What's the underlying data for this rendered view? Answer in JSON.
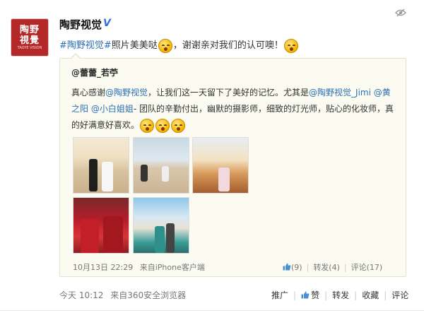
{
  "post": {
    "avatar": {
      "logo_top": "陶野",
      "logo_bottom": "視覺",
      "logo_sub": "TAOYE VISION"
    },
    "username": "陶野视觉",
    "verified_badge": "V",
    "text_tag": "#陶野视觉#",
    "text_main": "照片美美哒",
    "text_after": "，谢谢亲对我们的认可噢！",
    "footer": {
      "time": "今天 10:12",
      "source": "来自360安全浏览器",
      "actions": [
        "推广",
        "赞",
        "转发",
        "收藏",
        "评论"
      ]
    }
  },
  "quote": {
    "user": "@蕾蕾_若苧",
    "text_1": "真心感谢",
    "mention_1": "@陶野视觉",
    "text_2": "，让我们这一天留下了美好的记忆。尤其是",
    "mention_2": "@陶野视觉_Jimi",
    "mention_3": "@黄之阳",
    "mention_4": "@小白姐姐",
    "text_3": "- 团队的辛勤付出，幽默的摄影师，细致的灯光师，贴心的化妆师，真的好满意好喜欢。",
    "meta_time": "10月13日 22:29",
    "meta_source": "来自iPhone客户端",
    "likes": "(9)",
    "repost": "转发(4)",
    "comment": "评论(17)"
  },
  "icons": {
    "hide": "eye-off-icon",
    "emoji": "blush-face-icon",
    "like": "thumbs-up-icon"
  },
  "colors": {
    "link": "#2b6fb5",
    "avatar_bg": "#b42828",
    "quote_bg": "#fbfbf2"
  }
}
